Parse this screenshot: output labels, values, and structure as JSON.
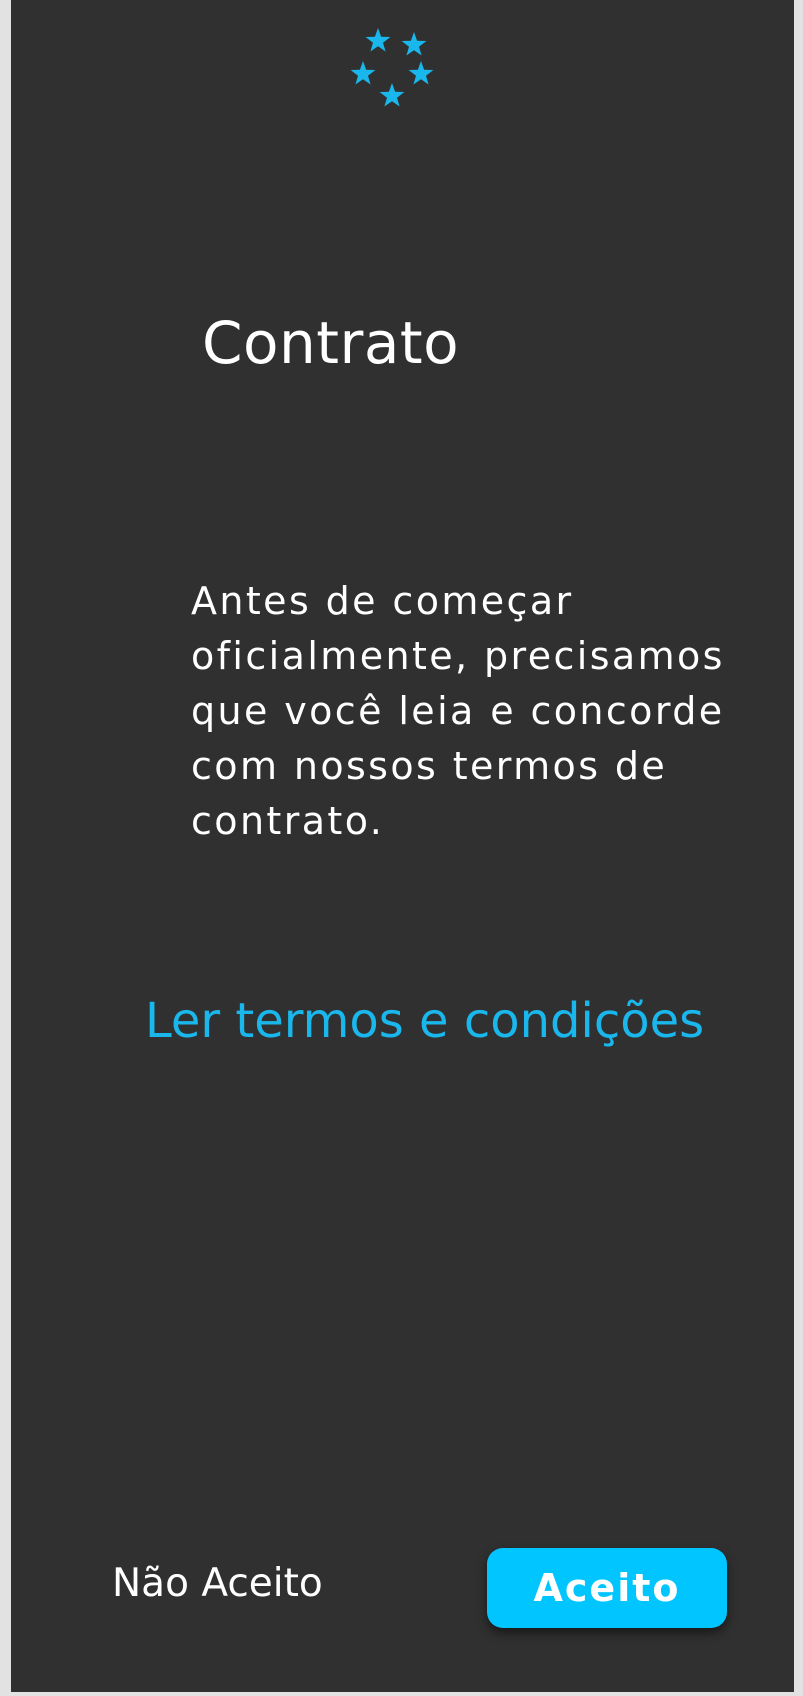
{
  "brand": {
    "logo_icon": "five-stars-icon",
    "accent_color": "#00c5ff",
    "link_color": "#1ab7ec",
    "background_color": "#303030"
  },
  "page": {
    "title": "Contrato",
    "intro": "Antes de começar oficialmente, precisamos que você leia e concorde com nossos termos de contrato.",
    "terms_link": "Ler termos e condições"
  },
  "actions": {
    "decline_label": "Não Aceito",
    "accept_label": "Aceito"
  }
}
